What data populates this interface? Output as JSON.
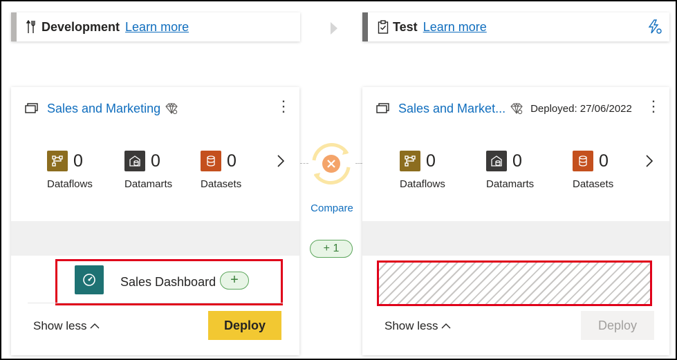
{
  "stages": [
    {
      "title": "Development",
      "learn_more": "Learn more"
    },
    {
      "title": "Test",
      "learn_more": "Learn more"
    }
  ],
  "cards": [
    {
      "workspace_name": "Sales and Marketing",
      "deployed": "",
      "items": [
        {
          "label": "Dataflows",
          "count": "0",
          "icon": "dataflow-icon",
          "color": "#8c6d1f"
        },
        {
          "label": "Datamarts",
          "count": "0",
          "icon": "datamart-icon",
          "color": "#3b3a39"
        },
        {
          "label": "Datasets",
          "count": "0",
          "icon": "dataset-icon",
          "color": "#c4501e"
        }
      ],
      "dashboard_name": "Sales Dashboard",
      "dashboard_diff": "+",
      "show_less": "Show less",
      "deploy_label": "Deploy"
    },
    {
      "workspace_name": "Sales and Market...",
      "deployed": "Deployed: 27/06/2022",
      "items": [
        {
          "label": "Dataflows",
          "count": "0",
          "icon": "dataflow-icon",
          "color": "#8c6d1f"
        },
        {
          "label": "Datamarts",
          "count": "0",
          "icon": "datamart-icon",
          "color": "#3b3a39"
        },
        {
          "label": "Datasets",
          "count": "0",
          "icon": "dataset-icon",
          "color": "#c4501e"
        }
      ],
      "show_less": "Show less",
      "deploy_label": "Deploy"
    }
  ],
  "compare": {
    "label": "Compare",
    "diff": "+ 1"
  },
  "colors": {
    "link": "#106ebe",
    "deploy": "#f2c832",
    "highlight": "#e0001a",
    "added": "#e8f5e6"
  }
}
